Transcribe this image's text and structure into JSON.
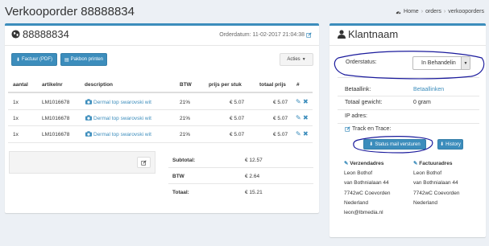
{
  "page": {
    "title": "Verkooporder 88888834"
  },
  "breadcrumb": {
    "home": "Home",
    "orders": "orders",
    "current": "verkooporders"
  },
  "order": {
    "number": "88888834",
    "date_text": "Orderdatum: 11-02-2017 21:04:38",
    "buttons": {
      "invoice": "Factuur (PDF)",
      "packslip": "Pakbon printen",
      "actions": "Acties"
    },
    "columns": [
      "aantal",
      "artikelnr",
      "description",
      "BTW",
      "prijs per stuk",
      "totaal prijs",
      "#"
    ],
    "rows": [
      {
        "qty": "1x",
        "sku": "LM1016678",
        "desc": "Dermal top swarovski wit",
        "vat": "21%",
        "unit": "€ 5.07",
        "total": "€ 5.07"
      },
      {
        "qty": "1x",
        "sku": "LM1016678",
        "desc": "Dermal top swarovski wit",
        "vat": "21%",
        "unit": "€ 5.07",
        "total": "€ 5.07"
      },
      {
        "qty": "1x",
        "sku": "LM1016678",
        "desc": "Dermal top swarovski wit",
        "vat": "21%",
        "unit": "€ 5.07",
        "total": "€ 5.07"
      }
    ],
    "totals": {
      "subtotal_label": "Subtotal:",
      "subtotal": "€ 12.57",
      "vat_label": "BTW",
      "vat": "€ 2.64",
      "total_label": "Totaal:",
      "total": "€ 15.21"
    }
  },
  "client": {
    "title": "Klantnaam",
    "status_label": "Orderstatus:",
    "status_value": "In Behandelin",
    "paylink_label": "Betaallink:",
    "paylink_value": "Betaallinken",
    "weight_label": "Totaal gewicht:",
    "weight_value": "0 gram",
    "ip_label": "IP adres:",
    "track_label": "Track en Trace:",
    "btn_mail": "Status mail versturen",
    "btn_history": "History",
    "shipping": {
      "title": "Verzendadres",
      "lines": [
        "Leon Bothof",
        "van Bothnialaan 44",
        "7742wC Coevorden",
        "Nederland",
        "leon@lbmedia.nl"
      ]
    },
    "billing": {
      "title": "Factuuradres",
      "lines": [
        "Leon Bothof",
        "van Bothnialaan 44",
        "7742wC Coevorden",
        "Nederland"
      ]
    }
  },
  "colors": {
    "primary": "#3c8dbc",
    "annotation": "#1a1a9c",
    "background": "#ecf0f5"
  }
}
